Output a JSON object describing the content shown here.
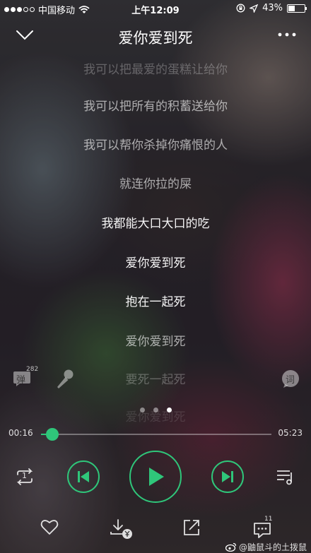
{
  "status_bar": {
    "carrier": "中国移动",
    "time": "上午12:09",
    "battery_text": "43%",
    "battery_level": 0.43
  },
  "header": {
    "song_title": "爱你爱到死"
  },
  "lyrics": [
    "我可以把最爱的蛋糕让给你",
    "我可以把所有的积蓄送给你",
    "我可以帮你杀掉你痛恨的人",
    "就连你拉的屎",
    "我都能大口大口的吃",
    "爱你爱到死",
    "抱在一起死",
    "爱你爱到死",
    "要死一起死",
    "爱你爱到死"
  ],
  "side_icons": {
    "danmu_label": "弹",
    "danmu_count": "282",
    "ci_label": "词"
  },
  "pager": {
    "pages": 3,
    "active_index": 2
  },
  "playback": {
    "current_time": "00:16",
    "total_time": "05:23",
    "progress": 0.05
  },
  "controls": {
    "repeat_badge": "1"
  },
  "bottom_bar": {
    "comment_count": "11",
    "watermark": "@鼬鼠斗的土拨鼠"
  },
  "colors": {
    "accent": "#2fc67a"
  }
}
